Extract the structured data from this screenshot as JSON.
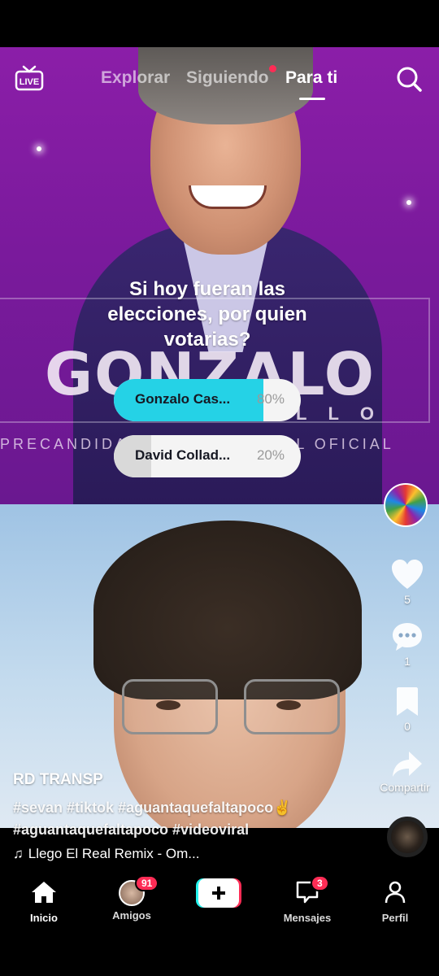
{
  "top_nav": {
    "live_label": "LIVE",
    "tabs": [
      {
        "label": "Explorar",
        "active": false
      },
      {
        "label": "Siguiendo",
        "active": false,
        "has_dot": true
      },
      {
        "label": "Para ti",
        "active": true
      }
    ]
  },
  "video_overlay": {
    "banner_word": "GONZALO",
    "banner_sub": "CASTILLO",
    "banner_line": "PRECANDIDATO PRESIDENCIAL OFICIAL"
  },
  "poll": {
    "question": "Si hoy fueran las elecciones, por quien votarias?",
    "options": [
      {
        "label": "Gonzalo Cas...",
        "percent": "80%",
        "fill": 0.8,
        "color": "#25d2e6"
      },
      {
        "label": "David Collad...",
        "percent": "20%",
        "fill": 0.2,
        "color": "#d9d9d9"
      }
    ]
  },
  "rail": {
    "likes": "5",
    "comments": "1",
    "saves": "0",
    "share_label": "Compartir"
  },
  "post": {
    "author": "RD TRANSP",
    "caption_line1": "#sevan #tiktok #aguantaquefaltapoco✌",
    "caption_line2": "#aguantaquefaltapoco #videoviral",
    "music": "Llego El Real Remix - Om..."
  },
  "bottom_nav": {
    "items": [
      {
        "label": "Inicio",
        "active": true
      },
      {
        "label": "Amigos",
        "badge": "91"
      },
      {
        "label": "create"
      },
      {
        "label": "Mensajes",
        "badge": "3"
      },
      {
        "label": "Perfil"
      }
    ]
  },
  "colors": {
    "accent_red": "#fe2c55",
    "accent_cyan": "#25f4ee",
    "poll_fill": "#25d2e6"
  }
}
